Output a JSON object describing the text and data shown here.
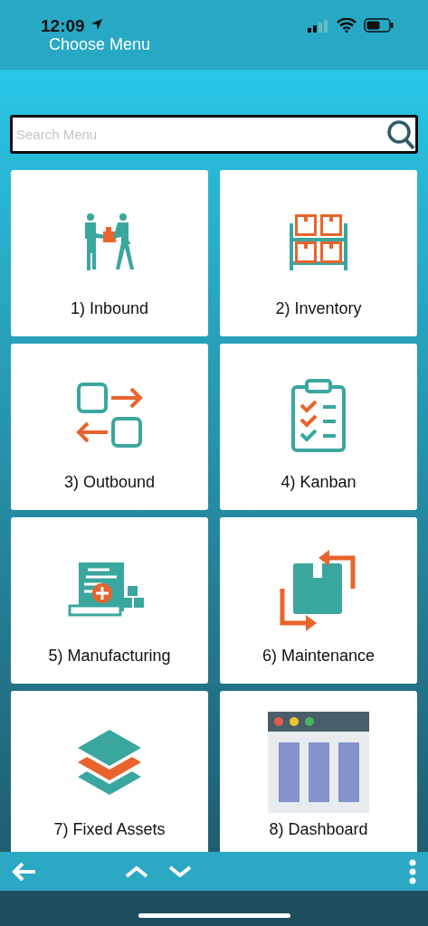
{
  "status_bar": {
    "time": "12:09"
  },
  "header": {
    "title": "Choose Menu"
  },
  "search": {
    "placeholder": "Search Menu"
  },
  "menu": [
    {
      "label": "1) Inbound",
      "kind": "handover"
    },
    {
      "label": "2) Inventory",
      "kind": "shelf"
    },
    {
      "label": "3) Outbound",
      "kind": "exchange"
    },
    {
      "label": "4) Kanban",
      "kind": "checklist"
    },
    {
      "label": "5) Manufacturing",
      "kind": "document"
    },
    {
      "label": "6) Maintenance",
      "kind": "cycle"
    },
    {
      "label": "7) Fixed Assets",
      "kind": "layers"
    },
    {
      "label": "8) Dashboard",
      "kind": "dashboard"
    }
  ]
}
